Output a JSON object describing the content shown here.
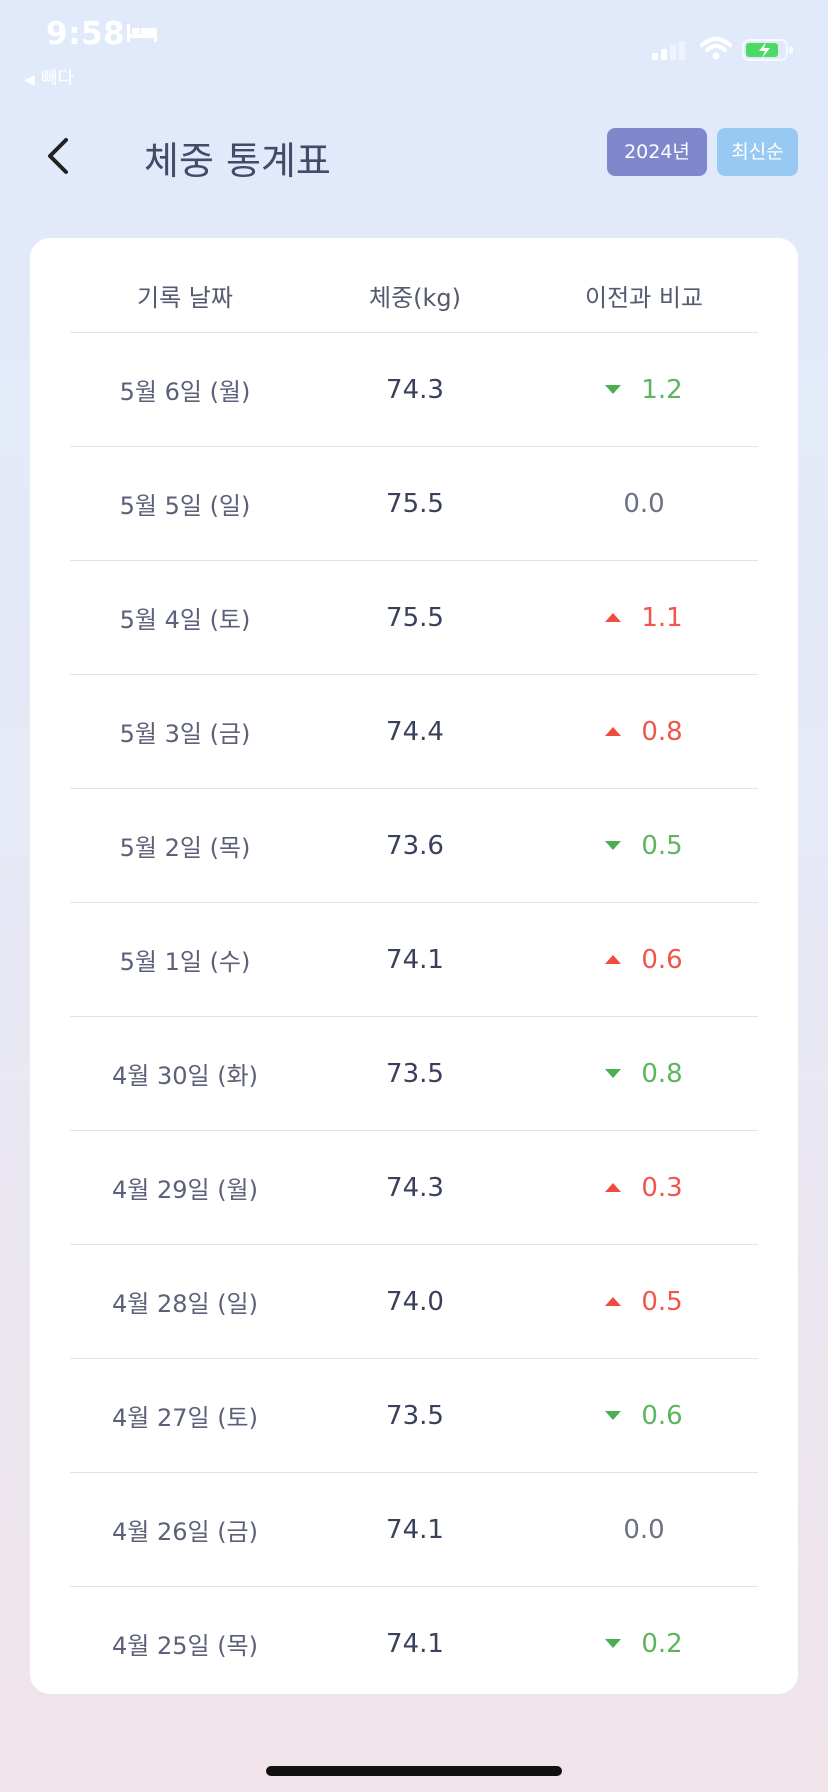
{
  "status_bar": {
    "time": "9:58",
    "back_app": "빼다"
  },
  "header": {
    "title": "체중 통계표",
    "year_label": "2024년",
    "sort_label": "최신순"
  },
  "table": {
    "headers": [
      "기록 날짜",
      "체중(kg)",
      "이전과 비교"
    ],
    "rows": [
      {
        "date": "5월 6일 (월)",
        "weight": "74.3",
        "diff": "1.2",
        "trend": "down"
      },
      {
        "date": "5월 5일 (일)",
        "weight": "75.5",
        "diff": "0.0",
        "trend": "same"
      },
      {
        "date": "5월 4일 (토)",
        "weight": "75.5",
        "diff": "1.1",
        "trend": "up"
      },
      {
        "date": "5월 3일 (금)",
        "weight": "74.4",
        "diff": "0.8",
        "trend": "up"
      },
      {
        "date": "5월 2일 (목)",
        "weight": "73.6",
        "diff": "0.5",
        "trend": "down"
      },
      {
        "date": "5월 1일 (수)",
        "weight": "74.1",
        "diff": "0.6",
        "trend": "up"
      },
      {
        "date": "4월 30일 (화)",
        "weight": "73.5",
        "diff": "0.8",
        "trend": "down"
      },
      {
        "date": "4월 29일 (월)",
        "weight": "74.3",
        "diff": "0.3",
        "trend": "up"
      },
      {
        "date": "4월 28일 (일)",
        "weight": "74.0",
        "diff": "0.5",
        "trend": "up"
      },
      {
        "date": "4월 27일 (토)",
        "weight": "73.5",
        "diff": "0.6",
        "trend": "down"
      },
      {
        "date": "4월 26일 (금)",
        "weight": "74.1",
        "diff": "0.0",
        "trend": "same"
      },
      {
        "date": "4월 25일 (목)",
        "weight": "74.1",
        "diff": "0.2",
        "trend": "down"
      }
    ]
  },
  "colors": {
    "year_button": "#8088cc",
    "sort_button": "#98c9f3",
    "decrease": "#4cae4f",
    "increase": "#f04c3e"
  }
}
